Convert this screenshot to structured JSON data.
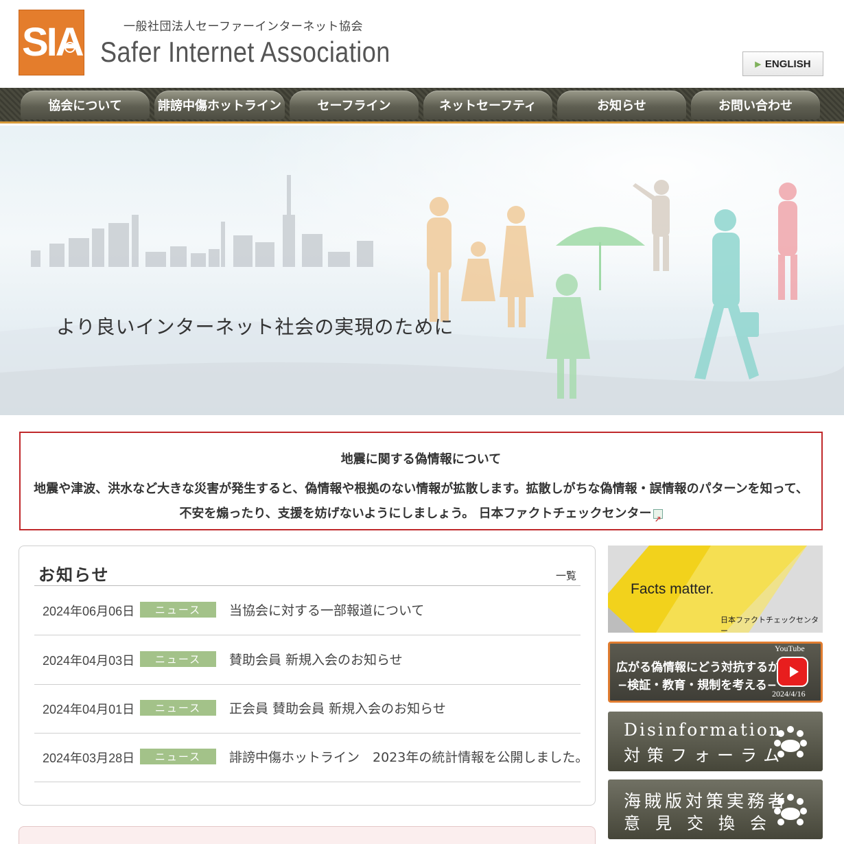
{
  "header": {
    "logo_text": "SIA",
    "org_name_jp": "一般社団法人セーファーインターネット協会",
    "org_name_en": "Safer Internet Association",
    "english_button": "ENGLISH"
  },
  "nav": {
    "items": [
      {
        "label": "協会について"
      },
      {
        "label": "誹謗中傷ホットライン"
      },
      {
        "label": "セーフライン"
      },
      {
        "label": "ネットセーフティ"
      },
      {
        "label": "お知らせ"
      },
      {
        "label": "お問い合わせ"
      }
    ]
  },
  "hero": {
    "tagline": "より良いインターネット社会の実現のために"
  },
  "alert": {
    "title": "地震に関する偽情報について",
    "body": "地震や津波、洪水など大きな災害が発生すると、偽情報や根拠のない情報が拡散します。拡散しがちな偽情報・誤情報のパターンを知って、不安を煽ったり、支援を妨げないようにしましょう。",
    "link_text": "日本ファクトチェックセンター"
  },
  "news": {
    "title": "お知らせ",
    "more_link": "一覧",
    "items": [
      {
        "date": "2024年06月06日",
        "tag": "ニュース",
        "text": "当協会に対する一部報道について"
      },
      {
        "date": "2024年04月03日",
        "tag": "ニュース",
        "text": "賛助会員 新規入会のお知らせ"
      },
      {
        "date": "2024年04月01日",
        "tag": "ニュース",
        "text": "正会員 賛助会員 新規入会のお知らせ"
      },
      {
        "date": "2024年03月28日",
        "tag": "ニュース",
        "text": "誹謗中傷ホットライン　2023年の統計情報を公開しました。"
      }
    ]
  },
  "sidebar": {
    "factcheck": {
      "tagline": "Facts matter.",
      "org": "日本ファクトチェックセンター"
    },
    "youtube": {
      "label": "YouTube",
      "line1": "広がる偽情報にどう対抗するか",
      "line2": "−検証・教育・規制を考える−",
      "date": "2024/4/16"
    },
    "banner1": {
      "line1": "Disinformation",
      "line2": "対策フォーラム"
    },
    "banner2": {
      "line1": "海賊版対策実務者",
      "line2": "意見交換会"
    }
  },
  "colors": {
    "logo_orange": "#e47d2c",
    "nav_accent": "#d69a3a",
    "alert_border": "#c0282a",
    "news_tag": "#a3c289",
    "youtube_red": "#e81e1e"
  }
}
